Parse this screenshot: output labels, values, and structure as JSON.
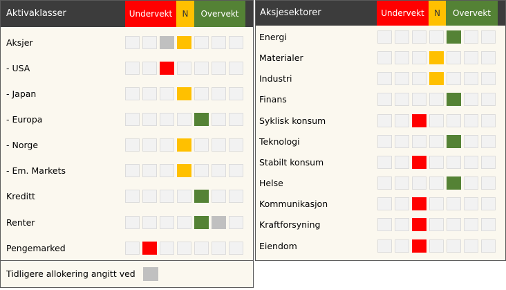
{
  "left_panel": {
    "title": "Aktivaklasser",
    "underweight_label": "Undervekt",
    "neutral_label": "N",
    "overweight_label": "Overvekt",
    "rows": [
      {
        "label": "Aksjer",
        "current": "neutral",
        "current_level": 4,
        "previous_level": 3
      },
      {
        "label": "- USA",
        "current": "under",
        "current_level": 3,
        "previous_level": null
      },
      {
        "label": "- Japan",
        "current": "neutral",
        "current_level": 4,
        "previous_level": null
      },
      {
        "label": "- Europa",
        "current": "over",
        "current_level": 5,
        "previous_level": null
      },
      {
        "label": "- Norge",
        "current": "neutral",
        "current_level": 4,
        "previous_level": null
      },
      {
        "label": "- Em. Markets",
        "current": "neutral",
        "current_level": 4,
        "previous_level": null
      },
      {
        "label": "Kreditt",
        "current": "over",
        "current_level": 5,
        "previous_level": null
      },
      {
        "label": "Renter",
        "current": "over",
        "current_level": 5,
        "previous_level": 6
      },
      {
        "label": "Pengemarked",
        "current": "under",
        "current_level": 2,
        "previous_level": null
      }
    ],
    "footer_label": "Tidligere allokering angitt ved"
  },
  "right_panel": {
    "title": "Aksjesektorer",
    "underweight_label": "Undervekt",
    "neutral_label": "N",
    "overweight_label": "Overvekt",
    "rows": [
      {
        "label": "Energi",
        "current": "over",
        "current_level": 5
      },
      {
        "label": "Materialer",
        "current": "neutral",
        "current_level": 4
      },
      {
        "label": "Industri",
        "current": "neutral",
        "current_level": 4
      },
      {
        "label": "Finans",
        "current": "over",
        "current_level": 5
      },
      {
        "label": "Syklisk konsum",
        "current": "under",
        "current_level": 3
      },
      {
        "label": "Teknologi",
        "current": "over",
        "current_level": 5
      },
      {
        "label": "Stabilt konsum",
        "current": "under",
        "current_level": 3
      },
      {
        "label": "Helse",
        "current": "over",
        "current_level": 5
      },
      {
        "label": "Kommunikasjon",
        "current": "under",
        "current_level": 3
      },
      {
        "label": "Kraftforsyning",
        "current": "under",
        "current_level": 3
      },
      {
        "label": "Eiendom",
        "current": "under",
        "current_level": 3
      }
    ]
  },
  "scale_steps": 7,
  "colors": {
    "under": "#ff0000",
    "neutral": "#ffc000",
    "over": "#548235",
    "previous": "#c0c0c0",
    "empty": "#f2f2f2",
    "header": "#3c3c3c",
    "panel_bg": "#fbf8ef"
  }
}
